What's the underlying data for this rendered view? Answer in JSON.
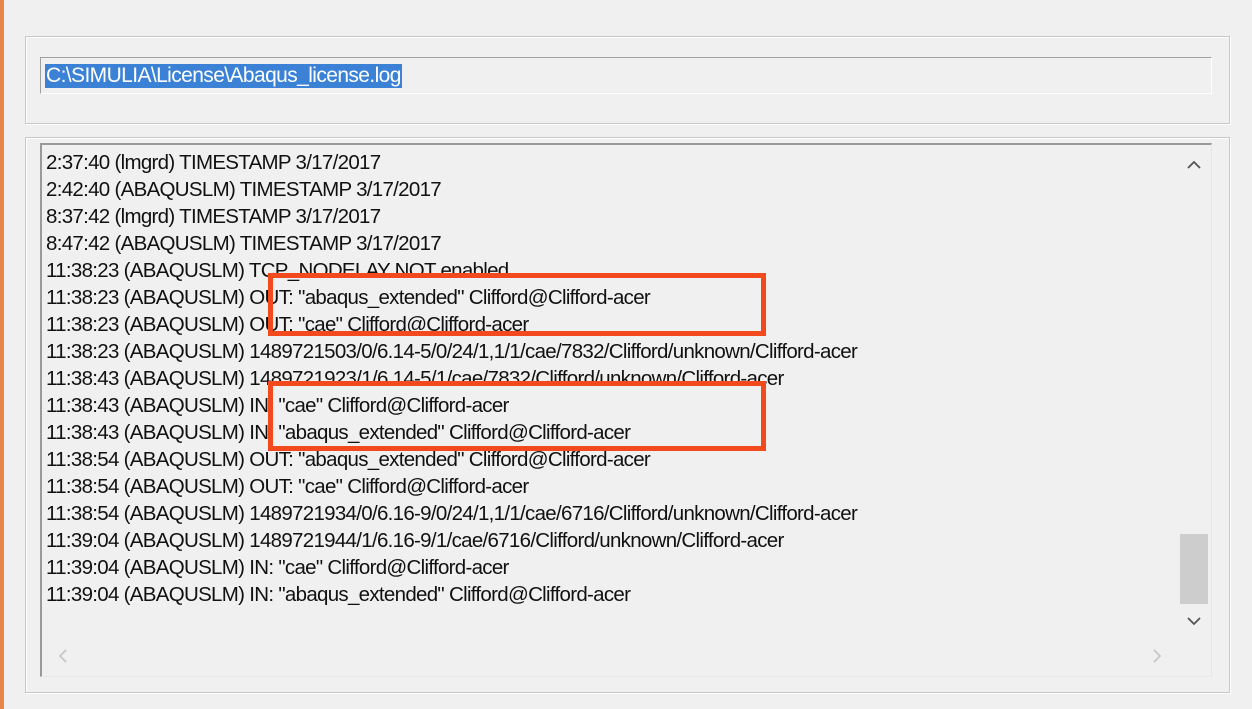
{
  "path_field": {
    "value": "C:\\SIMULIA\\License\\Abaqus_license.log"
  },
  "log": {
    "lines": [
      " 2:37:40 (lmgrd) TIMESTAMP 3/17/2017",
      " 2:42:40 (ABAQUSLM) TIMESTAMP 3/17/2017",
      " 8:37:42 (lmgrd) TIMESTAMP 3/17/2017",
      " 8:47:42 (ABAQUSLM) TIMESTAMP 3/17/2017",
      "11:38:23 (ABAQUSLM) TCP_NODELAY NOT enabled",
      "11:38:23 (ABAQUSLM) OUT: \"abaqus_extended\" Clifford@Clifford-acer",
      "11:38:23 (ABAQUSLM) OUT: \"cae\" Clifford@Clifford-acer",
      "11:38:23 (ABAQUSLM) 1489721503/0/6.14-5/0/24/1,1/1/cae/7832/Clifford/unknown/Clifford-acer",
      "11:38:43 (ABAQUSLM) 1489721923/1/6.14-5/1/cae/7832/Clifford/unknown/Clifford-acer",
      "11:38:43 (ABAQUSLM) IN: \"cae\" Clifford@Clifford-acer",
      "11:38:43 (ABAQUSLM) IN: \"abaqus_extended\" Clifford@Clifford-acer",
      "11:38:54 (ABAQUSLM) OUT: \"abaqus_extended\" Clifford@Clifford-acer",
      "11:38:54 (ABAQUSLM) OUT: \"cae\" Clifford@Clifford-acer",
      "11:38:54 (ABAQUSLM) 1489721934/0/6.16-9/0/24/1,1/1/cae/6716/Clifford/unknown/Clifford-acer",
      "11:39:04 (ABAQUSLM) 1489721944/1/6.16-9/1/cae/6716/Clifford/unknown/Clifford-acer",
      "11:39:04 (ABAQUSLM) IN: \"cae\" Clifford@Clifford-acer",
      "11:39:04 (ABAQUSLM) IN: \"abaqus_extended\" Clifford@Clifford-acer"
    ]
  },
  "scroll": {
    "up_icon": "▲",
    "down_icon": "▼",
    "left_icon": "<",
    "right_icon": ">",
    "vertical_position": 0.8
  },
  "colors": {
    "highlight": "#f24a1d",
    "selection": "#3b82d7",
    "accent_edge": "#e8854a"
  }
}
